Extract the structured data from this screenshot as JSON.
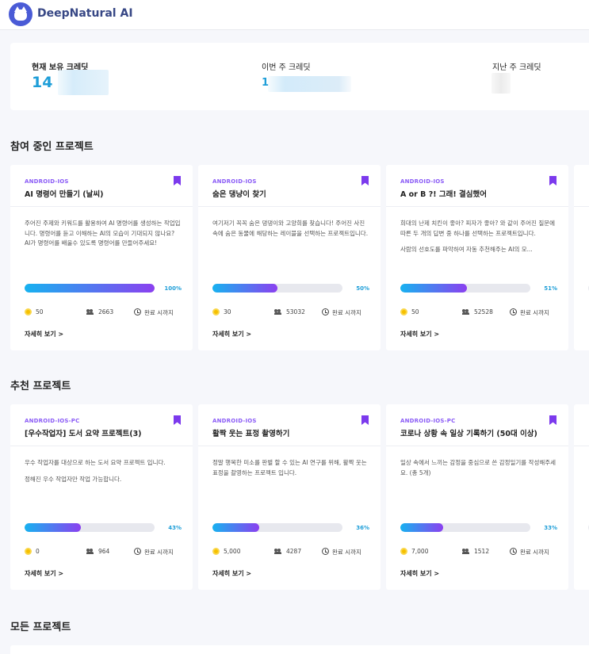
{
  "app": {
    "name": "DeepNatural AI"
  },
  "credits": {
    "current": {
      "label": "현재 보유 크레딧",
      "value": "14"
    },
    "this_week": {
      "label": "이번 주 크레딧",
      "value": "1"
    },
    "last_week": {
      "label": "지난 주 크레딧"
    }
  },
  "sections": {
    "participating": "참여 중인 프로젝트",
    "recommended": "추천 프로젝트",
    "all": "모든 프로젝트"
  },
  "labels": {
    "deadline": "완료 시까지",
    "more": "자세히 보기 >"
  },
  "participating_projects": [
    {
      "platform": "ANDROID-IOS",
      "title": "AI 명령어 만들기 (날씨)",
      "desc": [
        "주어진 주제와 키워드를 활용하여 AI 명령어를 생성하는 작업입니다. 명령어를 듣고 이해하는 AI의 모습이 기대되지 않나요? AI가 명령어를 배울수 있도록 명령어를 만들어주세요!"
      ],
      "progress": 100,
      "progress_label": "100%",
      "reward": "50",
      "participants": "2663"
    },
    {
      "platform": "ANDROID-IOS",
      "title": "숨은 댕냥이 찾기",
      "desc": [
        "여기저기 꼭꼭 숨은 댕댕이와 고양희를 찾습니다! 주어진 사진 속에 숨은 동물에 해당하는 레이블을 선택하는 프로젝트입니다."
      ],
      "progress": 50,
      "progress_label": "50%",
      "reward": "30",
      "participants": "53032"
    },
    {
      "platform": "ANDROID-IOS",
      "title": "A or B ?! 그래! 결심했어",
      "desc": [
        "희대의 난제 치킨이 좋아? 피자가 좋아? 와 같이 주어진 질문에 따른 두 개의 답변 중 하나를 선택하는 프로젝트입니다.",
        "사람의 선호도를 파악하여 자동 추천해주는 AI의 모..."
      ],
      "progress": 51,
      "progress_label": "51%",
      "reward": "50",
      "participants": "52528"
    }
  ],
  "recommended_projects": [
    {
      "platform": "ANDROID-IOS-PC",
      "title": "[우수작업자] 도서 요약 프로젝트(3)",
      "desc": [
        "우수 작업자를 대상으로 하는 도서 요약 프로젝트 입니다.",
        "정해진 우수 작업자만 작업 가능합니다."
      ],
      "progress": 43,
      "progress_label": "43%",
      "reward": "0",
      "participants": "964"
    },
    {
      "platform": "ANDROID-IOS",
      "title": "활짝 웃는 표정 촬영하기",
      "desc": [
        "정말 행복한 미소를 판별 할 수 있는 AI 연구를 위해, 활짝 웃는 표정을 촬영하는 프로젝트 입니다."
      ],
      "progress": 36,
      "progress_label": "36%",
      "reward": "5,000",
      "participants": "4287"
    },
    {
      "platform": "ANDROID-IOS-PC",
      "title": "코로나 상황 속 일상 기록하기 (50대 이상)",
      "desc": [
        "일상 속에서 느끼는 감정을 중심으로 쓴 감정일기를 작성해주세요. (총 5개)"
      ],
      "progress": 33,
      "progress_label": "33%",
      "reward": "7,000",
      "participants": "1512"
    }
  ]
}
